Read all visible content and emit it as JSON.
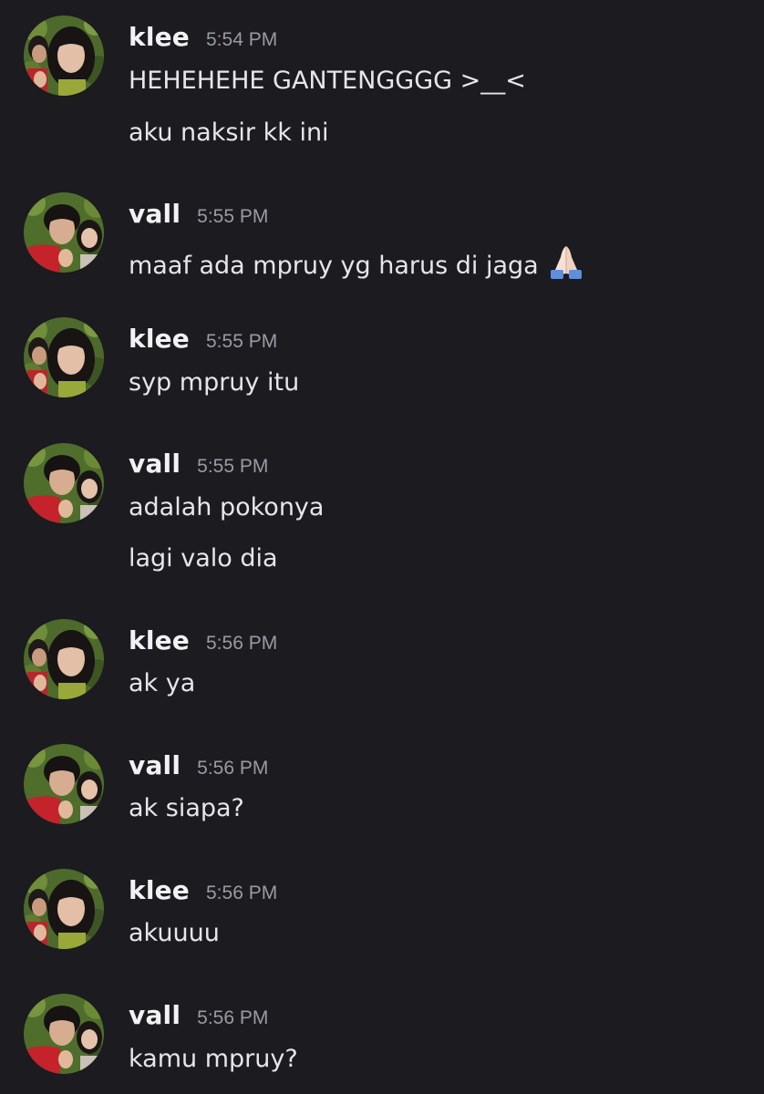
{
  "messages": [
    {
      "author": "klee",
      "time": "5:54 PM",
      "avatar": "klee-avatar",
      "lines": [
        "HEHEHEHE GANTENGGGG >__<",
        "aku naksir kk ini"
      ]
    },
    {
      "author": "vall",
      "time": "5:55 PM",
      "avatar": "vall-avatar",
      "lines": [
        "maaf ada mpruy yg harus di jaga"
      ],
      "emoji": "folded-hands-icon"
    },
    {
      "author": "klee",
      "time": "5:55 PM",
      "avatar": "klee-avatar",
      "lines": [
        "syp mpruy itu"
      ]
    },
    {
      "author": "vall",
      "time": "5:55 PM",
      "avatar": "vall-avatar",
      "lines": [
        "adalah pokonya",
        "lagi valo dia"
      ]
    },
    {
      "author": "klee",
      "time": "5:56 PM",
      "avatar": "klee-avatar",
      "lines": [
        "ak ya"
      ]
    },
    {
      "author": "vall",
      "time": "5:56 PM",
      "avatar": "vall-avatar",
      "lines": [
        "ak siapa?"
      ]
    },
    {
      "author": "klee",
      "time": "5:56 PM",
      "avatar": "klee-avatar",
      "lines": [
        "akuuuu"
      ]
    },
    {
      "author": "vall",
      "time": "5:56 PM",
      "avatar": "vall-avatar",
      "lines": [
        "kamu mpruy?"
      ]
    }
  ],
  "colors": {
    "background": "#1b1b20",
    "author": "#f2f2f5",
    "timestamp": "#9a9aa3",
    "message": "#e6e6ea"
  }
}
